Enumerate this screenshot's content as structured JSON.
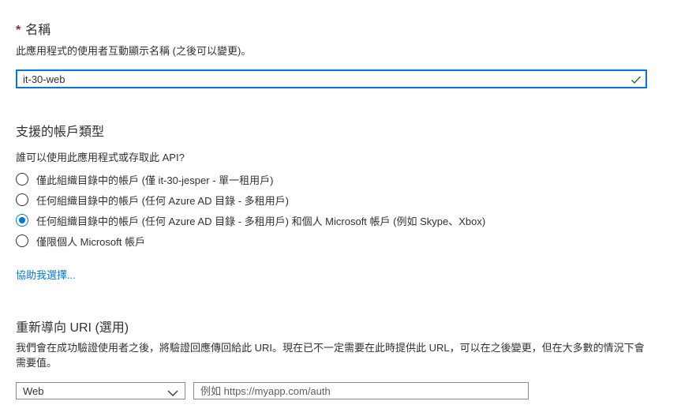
{
  "name_section": {
    "required_mark": "*",
    "title": "名稱",
    "description": "此應用程式的使用者互動顯示名稱 (之後可以變更)。",
    "input_value": "it-30-web",
    "valid_icon": "checkmark-icon"
  },
  "account_section": {
    "title": "支援的帳戶類型",
    "question": "誰可以使用此應用程式或存取此 API?",
    "options": [
      {
        "label": "僅此組織目錄中的帳戶 (僅 it-30-jesper - 單一租用戶)",
        "selected": false
      },
      {
        "label": "任何組織目錄中的帳戶 (任何 Azure AD 目錄 - 多租用戶)",
        "selected": false
      },
      {
        "label": "任何組織目錄中的帳戶 (任何 Azure AD 目錄 - 多租用戶) 和個人 Microsoft 帳戶 (例如 Skype、Xbox)",
        "selected": true
      },
      {
        "label": "僅限個人 Microsoft 帳戶",
        "selected": false
      }
    ],
    "help_link": "協助我選擇..."
  },
  "redirect_section": {
    "title": "重新導向 URI (選用)",
    "description_line1": "我們會在成功驗證使用者之後，將驗證回應傳回給此 URI。現在已不一定需要在此時提供此 URL，可以在之後變更，但在大多數的情況下會",
    "description_line2": "需要值。",
    "platform_select_value": "Web",
    "uri_placeholder": "例如 https://myapp.com/auth"
  },
  "colors": {
    "accent": "#0078d4",
    "required": "#a4262c",
    "valid": "#107c10",
    "text": "#323130"
  }
}
